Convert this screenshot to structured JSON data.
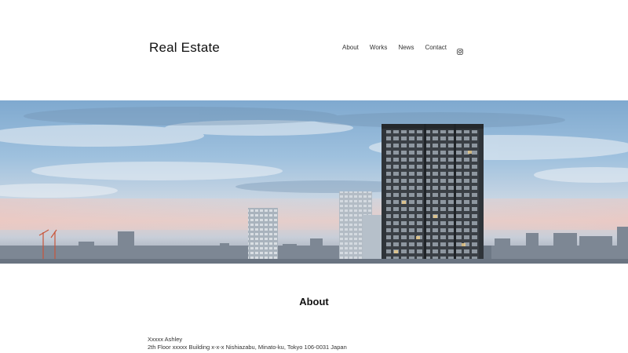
{
  "header": {
    "site_title": "Real Estate",
    "nav": [
      {
        "label": "About"
      },
      {
        "label": "Works"
      },
      {
        "label": "News"
      },
      {
        "label": "Contact"
      }
    ],
    "social_icon": "instagram-icon"
  },
  "hero": {
    "image": "city-skyline-photo"
  },
  "about": {
    "heading": "About",
    "name": "Xxxxx Ashley",
    "address": "2th Floor xxxxx Building x-x-x Nishiazabu, Minato-ku, Tokyo 106-0031 Japan"
  },
  "colors": {
    "background": "#ffffff",
    "text": "#222222",
    "sky_top": "#8eb6d6",
    "sky_horizon": "#e7c8c3"
  }
}
